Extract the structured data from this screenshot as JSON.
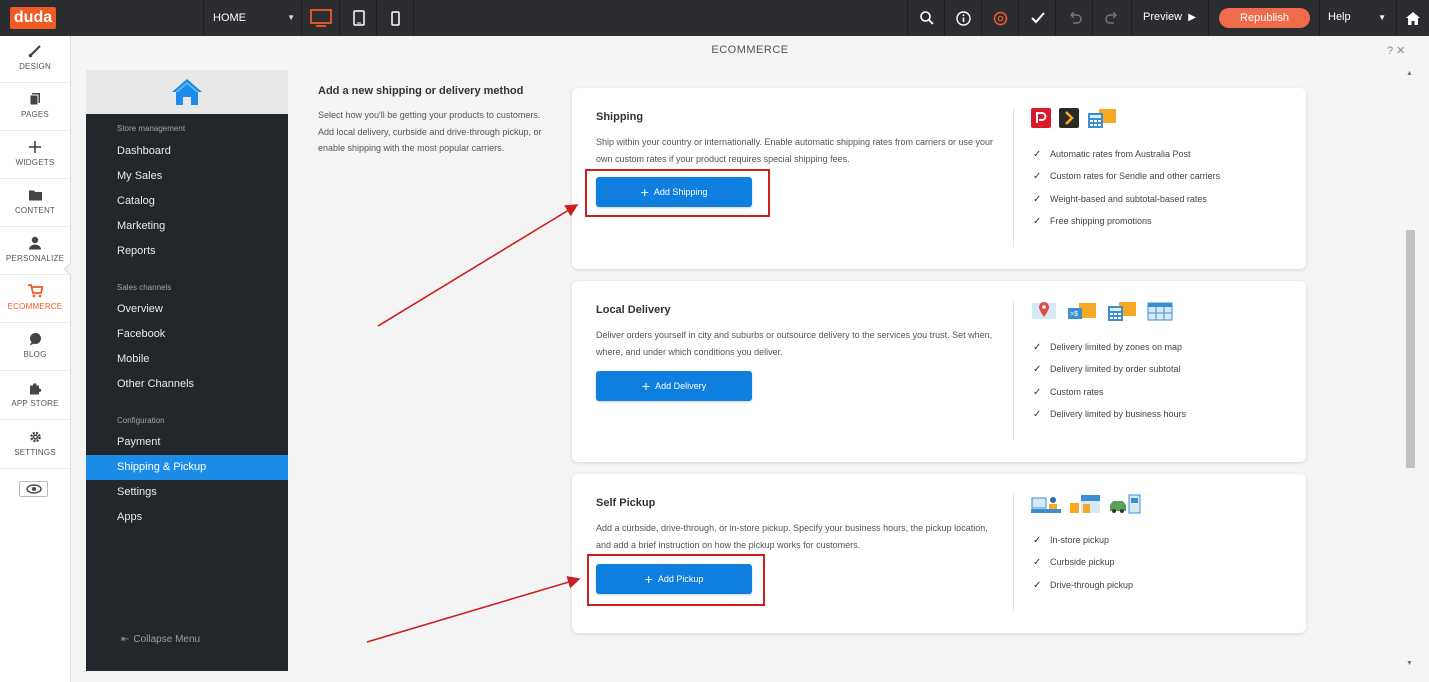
{
  "app": {
    "logo": "duda",
    "page_select": "HOME",
    "preview": "Preview",
    "republish": "Republish",
    "help": "Help"
  },
  "rail": {
    "items": [
      {
        "label": "DESIGN",
        "icon": "brush-icon"
      },
      {
        "label": "PAGES",
        "icon": "pages-icon"
      },
      {
        "label": "WIDGETS",
        "icon": "plus-icon"
      },
      {
        "label": "CONTENT",
        "icon": "folder-icon"
      },
      {
        "label": "PERSONALIZE",
        "icon": "person-icon"
      },
      {
        "label": "ECOMMERCE",
        "icon": "cart-icon"
      },
      {
        "label": "BLOG",
        "icon": "chat-icon"
      },
      {
        "label": "APP STORE",
        "icon": "puzzle-icon"
      },
      {
        "label": "SETTINGS",
        "icon": "gear-icon"
      }
    ]
  },
  "panel": {
    "title": "ECOMMERCE",
    "actions": "?  ✕"
  },
  "store_nav": {
    "sections": [
      {
        "title": "Store management",
        "items": [
          "Dashboard",
          "My Sales",
          "Catalog",
          "Marketing",
          "Reports"
        ]
      },
      {
        "title": "Sales channels",
        "items": [
          "Overview",
          "Facebook",
          "Mobile",
          "Other Channels"
        ]
      },
      {
        "title": "Configuration",
        "items": [
          "Payment",
          "Shipping & Pickup",
          "Settings",
          "Apps"
        ]
      }
    ],
    "active_item": "Shipping & Pickup",
    "collapse": "Collapse Menu"
  },
  "intro": {
    "title": "Add a new shipping or delivery method",
    "text": "Select how you'll be getting your products to customers. Add local delivery, curbside and drive-through pickup, or enable shipping with the most popular carriers."
  },
  "cards": [
    {
      "title": "Shipping",
      "description": "Ship within your country or internationally. Enable automatic shipping rates from carriers or use your own custom rates if your product requires special shipping fees.",
      "button": "Add Shipping",
      "features": [
        "Automatic rates from Australia Post",
        "Custom rates for Sendle and other carriers",
        "Weight-based and subtotal-based rates",
        "Free shipping promotions"
      ]
    },
    {
      "title": "Local Delivery",
      "description": "Deliver orders yourself in city and suburbs or outsource delivery to the services you trust. Set when, where, and under which conditions you deliver.",
      "button": "Add Delivery",
      "features": [
        "Delivery limited by zones on map",
        "Delivery limited by order subtotal",
        "Custom rates",
        "Delivery limited by business hours"
      ]
    },
    {
      "title": "Self Pickup",
      "description": "Add a curbside, drive-through, or in-store pickup. Specify your business hours, the pickup location, and add a brief instruction on how the pickup works for customers.",
      "button": "Add Pickup",
      "features": [
        "In-store pickup",
        "Curbside pickup",
        "Drive-through pickup"
      ]
    }
  ],
  "colors": {
    "accent": "#0e7fdf",
    "brand": "#f15a24",
    "republish": "#f06b4b",
    "nav_active": "#1b8de8",
    "sidebar_bg": "#23262b",
    "annotation": "#cc1f1f"
  }
}
